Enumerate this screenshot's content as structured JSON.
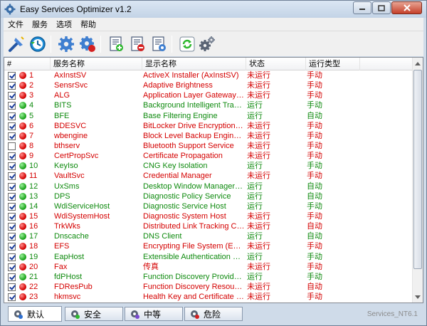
{
  "window": {
    "title": "Easy Services Optimizer v1.2"
  },
  "menu": [
    "文件",
    "服务",
    "选项",
    "帮助"
  ],
  "toolbar": {
    "icons": [
      "optimize-icon",
      "restore-clock-icon",
      "settings-gear-blue-icon",
      "settings-gear-red-icon",
      "add-list-icon",
      "remove-list-icon",
      "edit-list-icon",
      "refresh-icon",
      "services-gear-icon"
    ]
  },
  "table": {
    "headers": {
      "num": "#",
      "name": "服务名称",
      "display": "显示名称",
      "state": "状态",
      "type": "运行类型"
    },
    "rows": [
      {
        "checked": true,
        "status": "red",
        "num": "1",
        "name": "AxInstSV",
        "display": "ActiveX Installer (AxInstSV)",
        "state": "未运行",
        "type": "手动"
      },
      {
        "checked": true,
        "status": "red",
        "num": "2",
        "name": "SensrSvc",
        "display": "Adaptive Brightness",
        "state": "未运行",
        "type": "手动"
      },
      {
        "checked": true,
        "status": "red",
        "num": "3",
        "name": "ALG",
        "display": "Application Layer Gateway Ser...",
        "state": "未运行",
        "type": "手动"
      },
      {
        "checked": true,
        "status": "green",
        "num": "4",
        "name": "BITS",
        "display": "Background Intelligent Transfer...",
        "state": "运行",
        "type": "手动"
      },
      {
        "checked": true,
        "status": "green",
        "num": "5",
        "name": "BFE",
        "display": "Base Filtering Engine",
        "state": "运行",
        "type": "自动"
      },
      {
        "checked": true,
        "status": "red",
        "num": "6",
        "name": "BDESVC",
        "display": "BitLocker Drive Encryption Service",
        "state": "未运行",
        "type": "手动"
      },
      {
        "checked": true,
        "status": "red",
        "num": "7",
        "name": "wbengine",
        "display": "Block Level Backup Engine Service",
        "state": "未运行",
        "type": "手动"
      },
      {
        "checked": false,
        "status": "red",
        "num": "8",
        "name": "bthserv",
        "display": "Bluetooth Support Service",
        "state": "未运行",
        "type": "手动"
      },
      {
        "checked": true,
        "status": "red",
        "num": "9",
        "name": "CertPropSvc",
        "display": "Certificate Propagation",
        "state": "未运行",
        "type": "手动"
      },
      {
        "checked": true,
        "status": "green",
        "num": "10",
        "name": "KeyIso",
        "display": "CNG Key Isolation",
        "state": "运行",
        "type": "手动"
      },
      {
        "checked": true,
        "status": "red",
        "num": "11",
        "name": "VaultSvc",
        "display": "Credential Manager",
        "state": "未运行",
        "type": "手动"
      },
      {
        "checked": true,
        "status": "green",
        "num": "12",
        "name": "UxSms",
        "display": "Desktop Window Manager Sess...",
        "state": "运行",
        "type": "自动"
      },
      {
        "checked": true,
        "status": "green",
        "num": "13",
        "name": "DPS",
        "display": "Diagnostic Policy Service",
        "state": "运行",
        "type": "自动"
      },
      {
        "checked": true,
        "status": "green",
        "num": "14",
        "name": "WdiServiceHost",
        "display": "Diagnostic Service Host",
        "state": "运行",
        "type": "手动"
      },
      {
        "checked": true,
        "status": "red",
        "num": "15",
        "name": "WdiSystemHost",
        "display": "Diagnostic System Host",
        "state": "未运行",
        "type": "手动"
      },
      {
        "checked": true,
        "status": "red",
        "num": "16",
        "name": "TrkWks",
        "display": "Distributed Link Tracking Client",
        "state": "未运行",
        "type": "自动"
      },
      {
        "checked": true,
        "status": "green",
        "num": "17",
        "name": "Dnscache",
        "display": "DNS Client",
        "state": "运行",
        "type": "自动"
      },
      {
        "checked": true,
        "status": "red",
        "num": "18",
        "name": "EFS",
        "display": "Encrypting File System (EFS)",
        "state": "未运行",
        "type": "手动"
      },
      {
        "checked": true,
        "status": "green",
        "num": "19",
        "name": "EapHost",
        "display": "Extensible Authentication Proto...",
        "state": "运行",
        "type": "手动"
      },
      {
        "checked": true,
        "status": "red",
        "num": "20",
        "name": "Fax",
        "display": "传真",
        "state": "未运行",
        "type": "手动"
      },
      {
        "checked": true,
        "status": "green",
        "num": "21",
        "name": "fdPHost",
        "display": "Function Discovery Provider Host",
        "state": "运行",
        "type": "手动"
      },
      {
        "checked": true,
        "status": "red",
        "num": "22",
        "name": "FDResPub",
        "display": "Function Discovery Resource P...",
        "state": "未运行",
        "type": "自动"
      },
      {
        "checked": true,
        "status": "red",
        "num": "23",
        "name": "hkmsvc",
        "display": "Health Key and Certificate Man...",
        "state": "未运行",
        "type": "手动"
      }
    ]
  },
  "tabs": [
    {
      "label": "默认",
      "active": true
    },
    {
      "label": "安全",
      "active": false
    },
    {
      "label": "中等",
      "active": false
    },
    {
      "label": "危险",
      "active": false
    }
  ],
  "status_text": "Services_NT6.1",
  "colors": {
    "running": "#0e8a0e",
    "stopped": "#d40000",
    "frame": "#cfdbe9"
  }
}
